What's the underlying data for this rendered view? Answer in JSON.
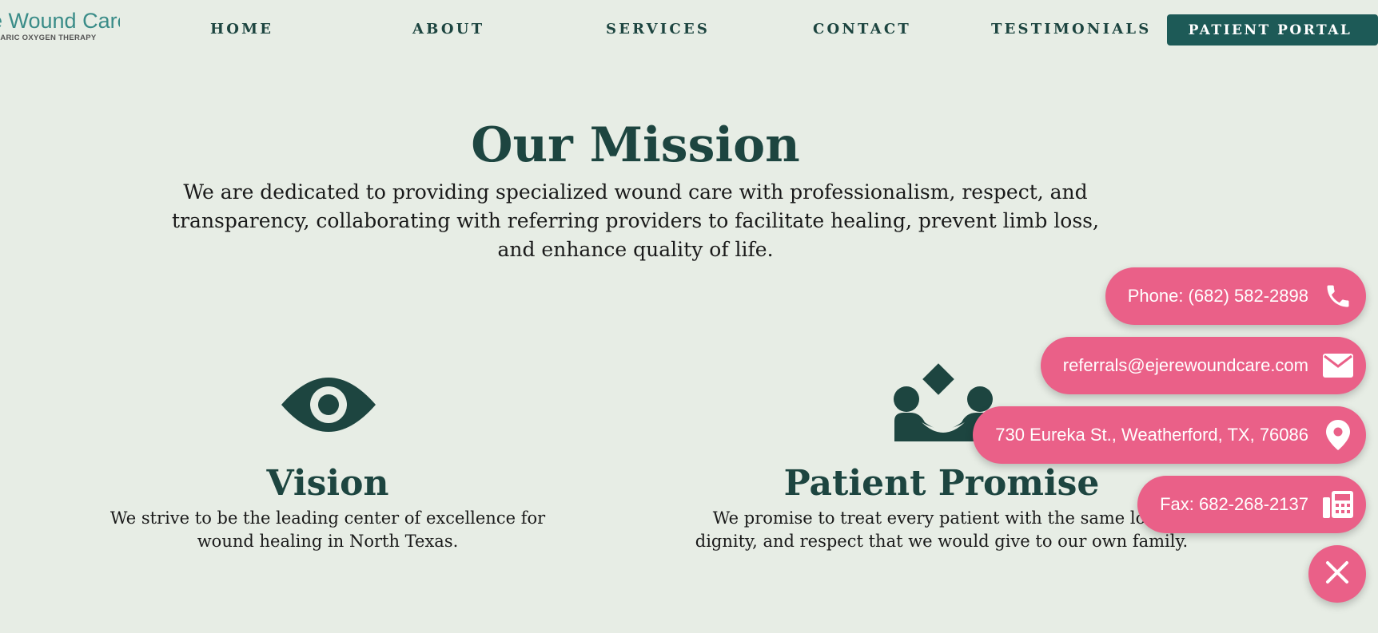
{
  "logo": {
    "title": "e Wound Care",
    "subtitle": "RBARIC OXYGEN THERAPY"
  },
  "nav": {
    "home": "HOME",
    "about": "ABOUT",
    "services": "SERVICES",
    "contact": "CONTACT",
    "testimonials": "TESTIMONIALS",
    "portal": "PATIENT PORTAL"
  },
  "mission": {
    "title": "Our Mission",
    "text": "We are dedicated to providing specialized wound care with professionalism, respect, and transparency, collaborating with referring providers to facilitate healing, prevent limb loss, and enhance quality of life."
  },
  "vision": {
    "icon": "eye-icon",
    "title": "Vision",
    "text": "We strive to be the leading center of excellence for wound healing in North Texas."
  },
  "promise": {
    "icon": "people-care-icon",
    "title": "Patient Promise",
    "text": "We promise to treat every patient with the same love, dignity, and respect that we would give to our own family."
  },
  "contact_widget": {
    "phone": "Phone: (682) 582-2898",
    "email": "referrals@ejerewoundcare.com",
    "address": "730 Eureka St., Weatherford, TX, 76086",
    "fax": "Fax: 682-268-2137"
  },
  "colors": {
    "background": "#e7ede5",
    "primary_dark": "#1d4540",
    "portal_button": "#1d5a57",
    "accent_pink": "#ea6088",
    "logo_teal": "#3a8c88"
  }
}
